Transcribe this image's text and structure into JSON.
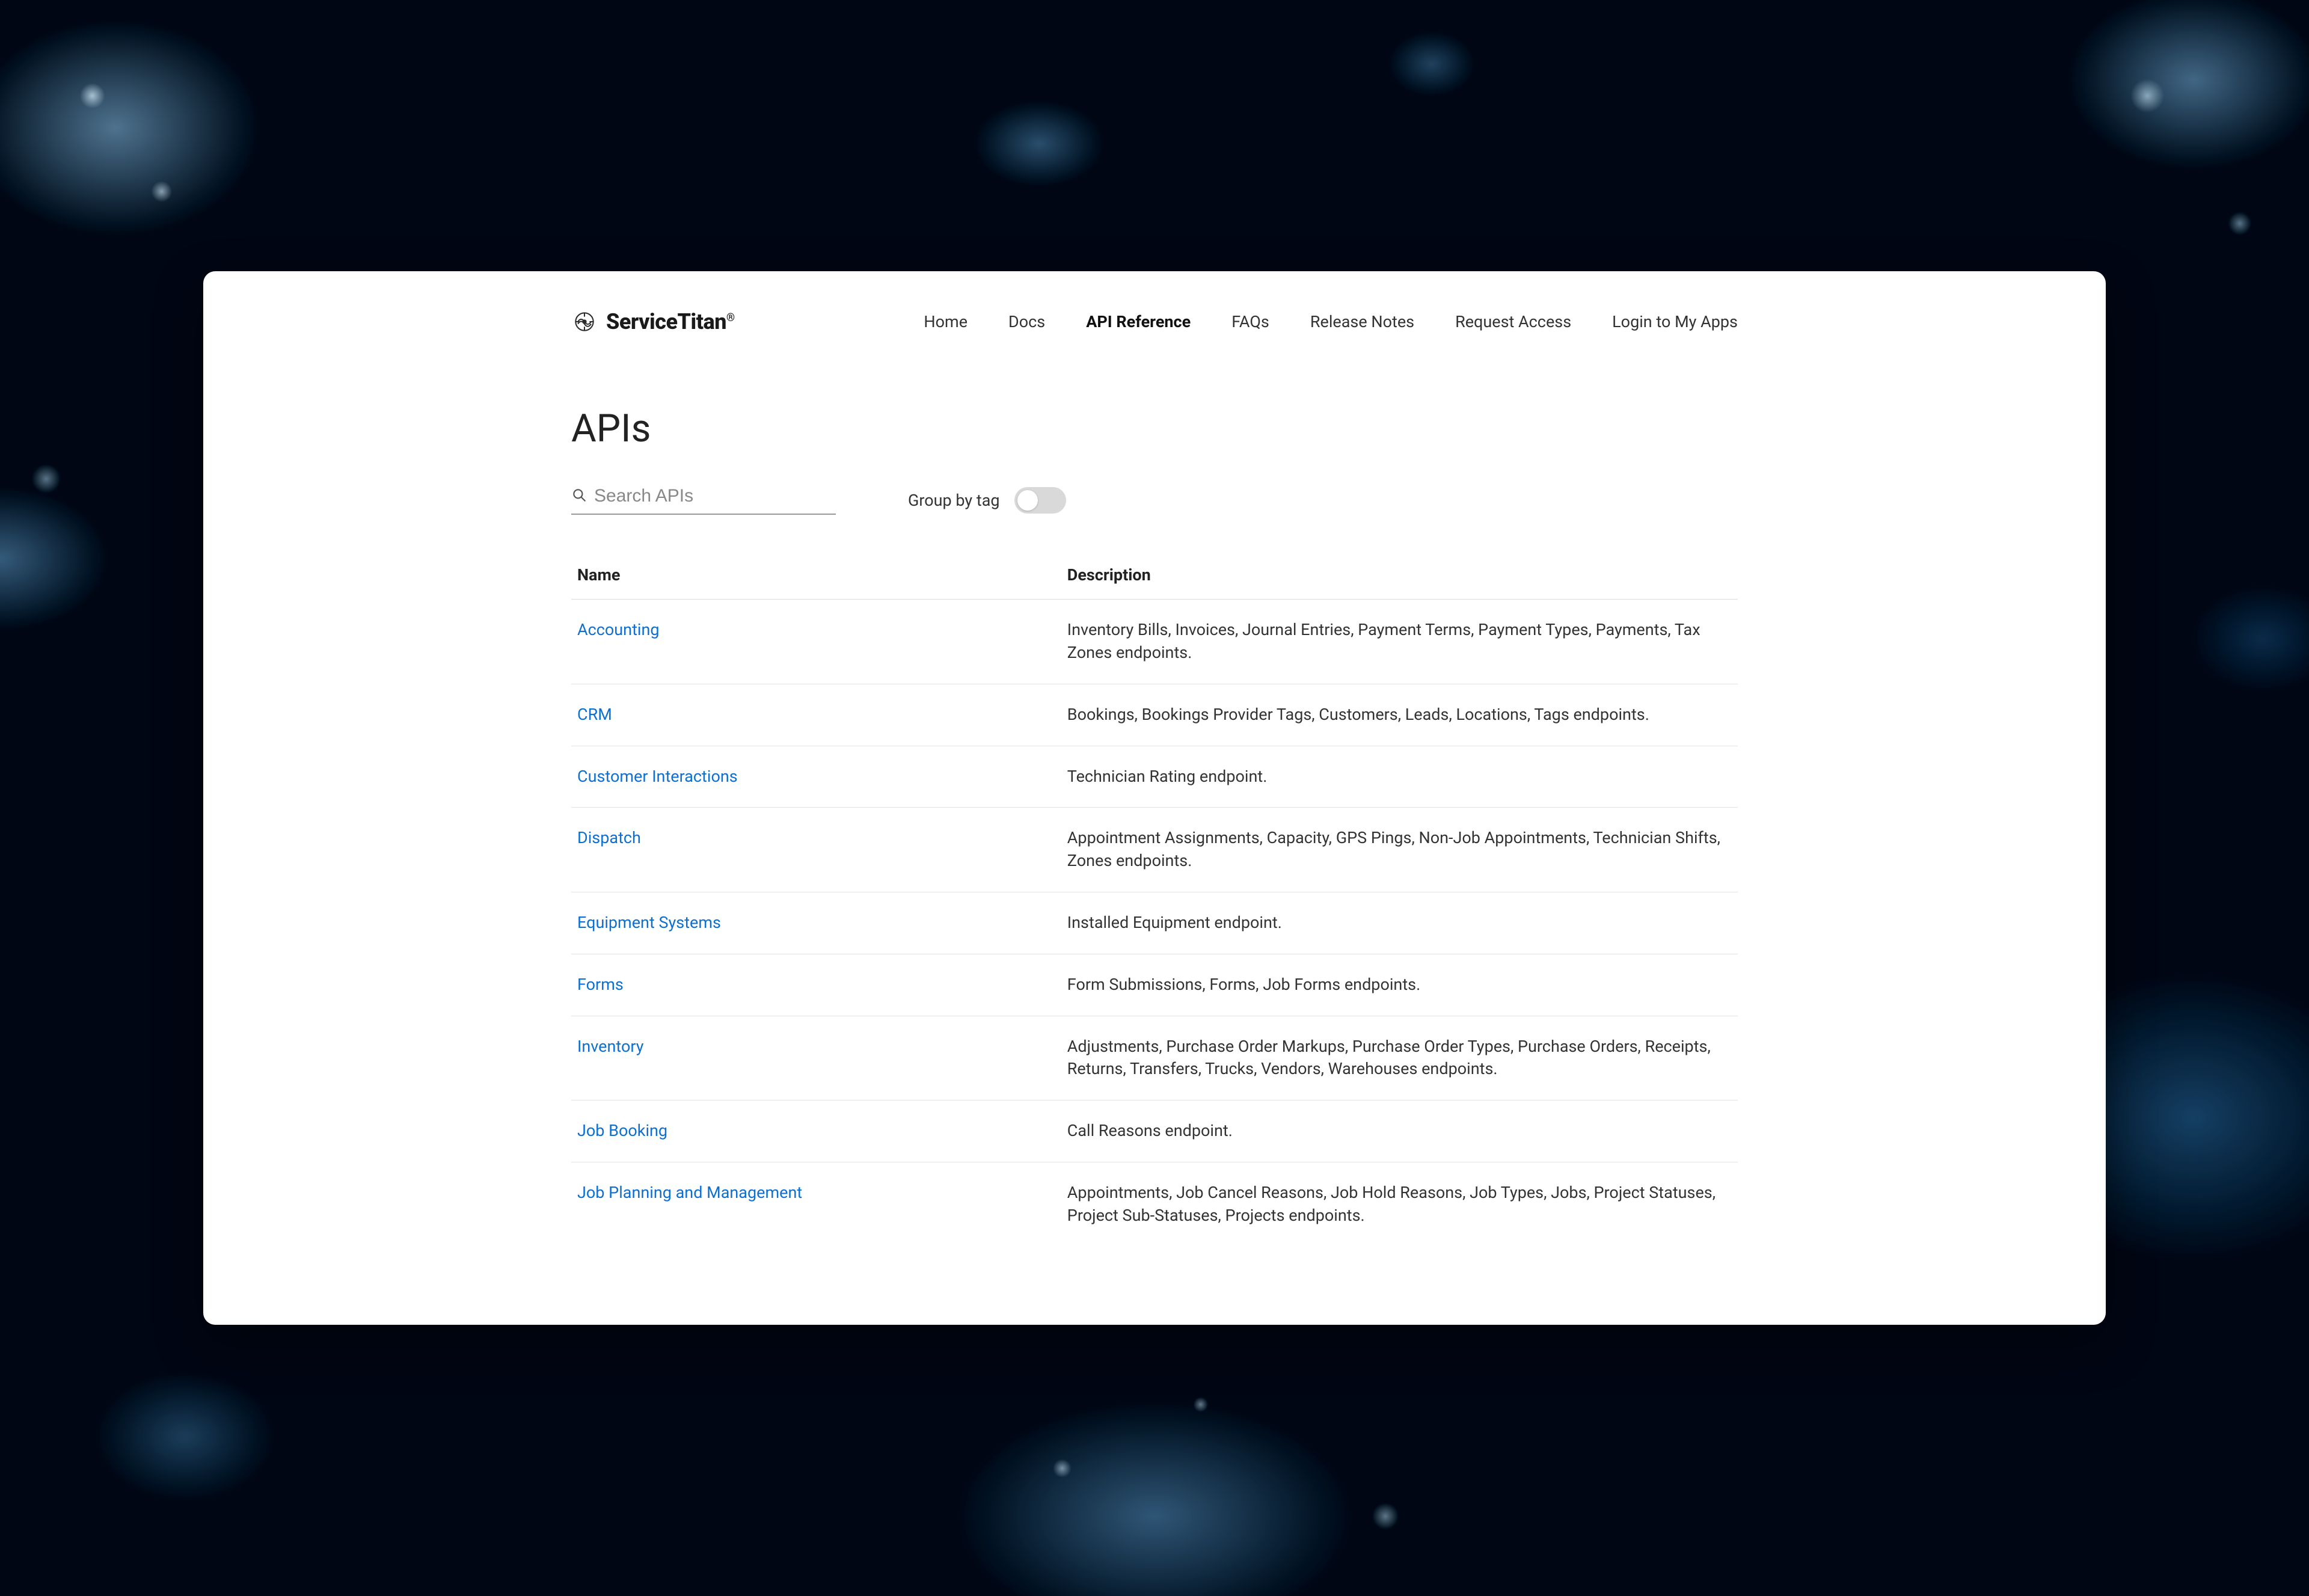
{
  "brand": {
    "name": "ServiceTitan"
  },
  "nav": {
    "items": [
      {
        "label": "Home",
        "active": false
      },
      {
        "label": "Docs",
        "active": false
      },
      {
        "label": "API Reference",
        "active": true
      },
      {
        "label": "FAQs",
        "active": false
      },
      {
        "label": "Release Notes",
        "active": false
      },
      {
        "label": "Request Access",
        "active": false
      },
      {
        "label": "Login to My Apps",
        "active": false
      }
    ]
  },
  "page": {
    "title": "APIs"
  },
  "search": {
    "placeholder": "Search APIs",
    "value": ""
  },
  "group_toggle": {
    "label": "Group by tag",
    "on": false
  },
  "table": {
    "columns": {
      "name": "Name",
      "description": "Description"
    },
    "rows": [
      {
        "name": "Accounting",
        "description": "Inventory Bills, Invoices, Journal Entries, Payment Terms, Payment Types, Payments, Tax Zones endpoints."
      },
      {
        "name": "CRM",
        "description": "Bookings, Bookings Provider Tags, Customers, Leads, Locations, Tags endpoints."
      },
      {
        "name": "Customer Interactions",
        "description": "Technician Rating endpoint."
      },
      {
        "name": "Dispatch",
        "description": "Appointment Assignments, Capacity, GPS Pings, Non-Job Appointments, Technician Shifts, Zones endpoints."
      },
      {
        "name": "Equipment Systems",
        "description": "Installed Equipment endpoint."
      },
      {
        "name": "Forms",
        "description": "Form Submissions, Forms, Job Forms endpoints."
      },
      {
        "name": "Inventory",
        "description": "Adjustments, Purchase Order Markups, Purchase Order Types, Purchase Orders, Receipts, Returns, Transfers, Trucks, Vendors, Warehouses endpoints."
      },
      {
        "name": "Job Booking",
        "description": "Call Reasons endpoint."
      },
      {
        "name": "Job Planning and Management",
        "description": "Appointments, Job Cancel Reasons, Job Hold Reasons, Job Types, Jobs, Project Statuses, Project Sub-Statuses, Projects endpoints."
      }
    ]
  }
}
